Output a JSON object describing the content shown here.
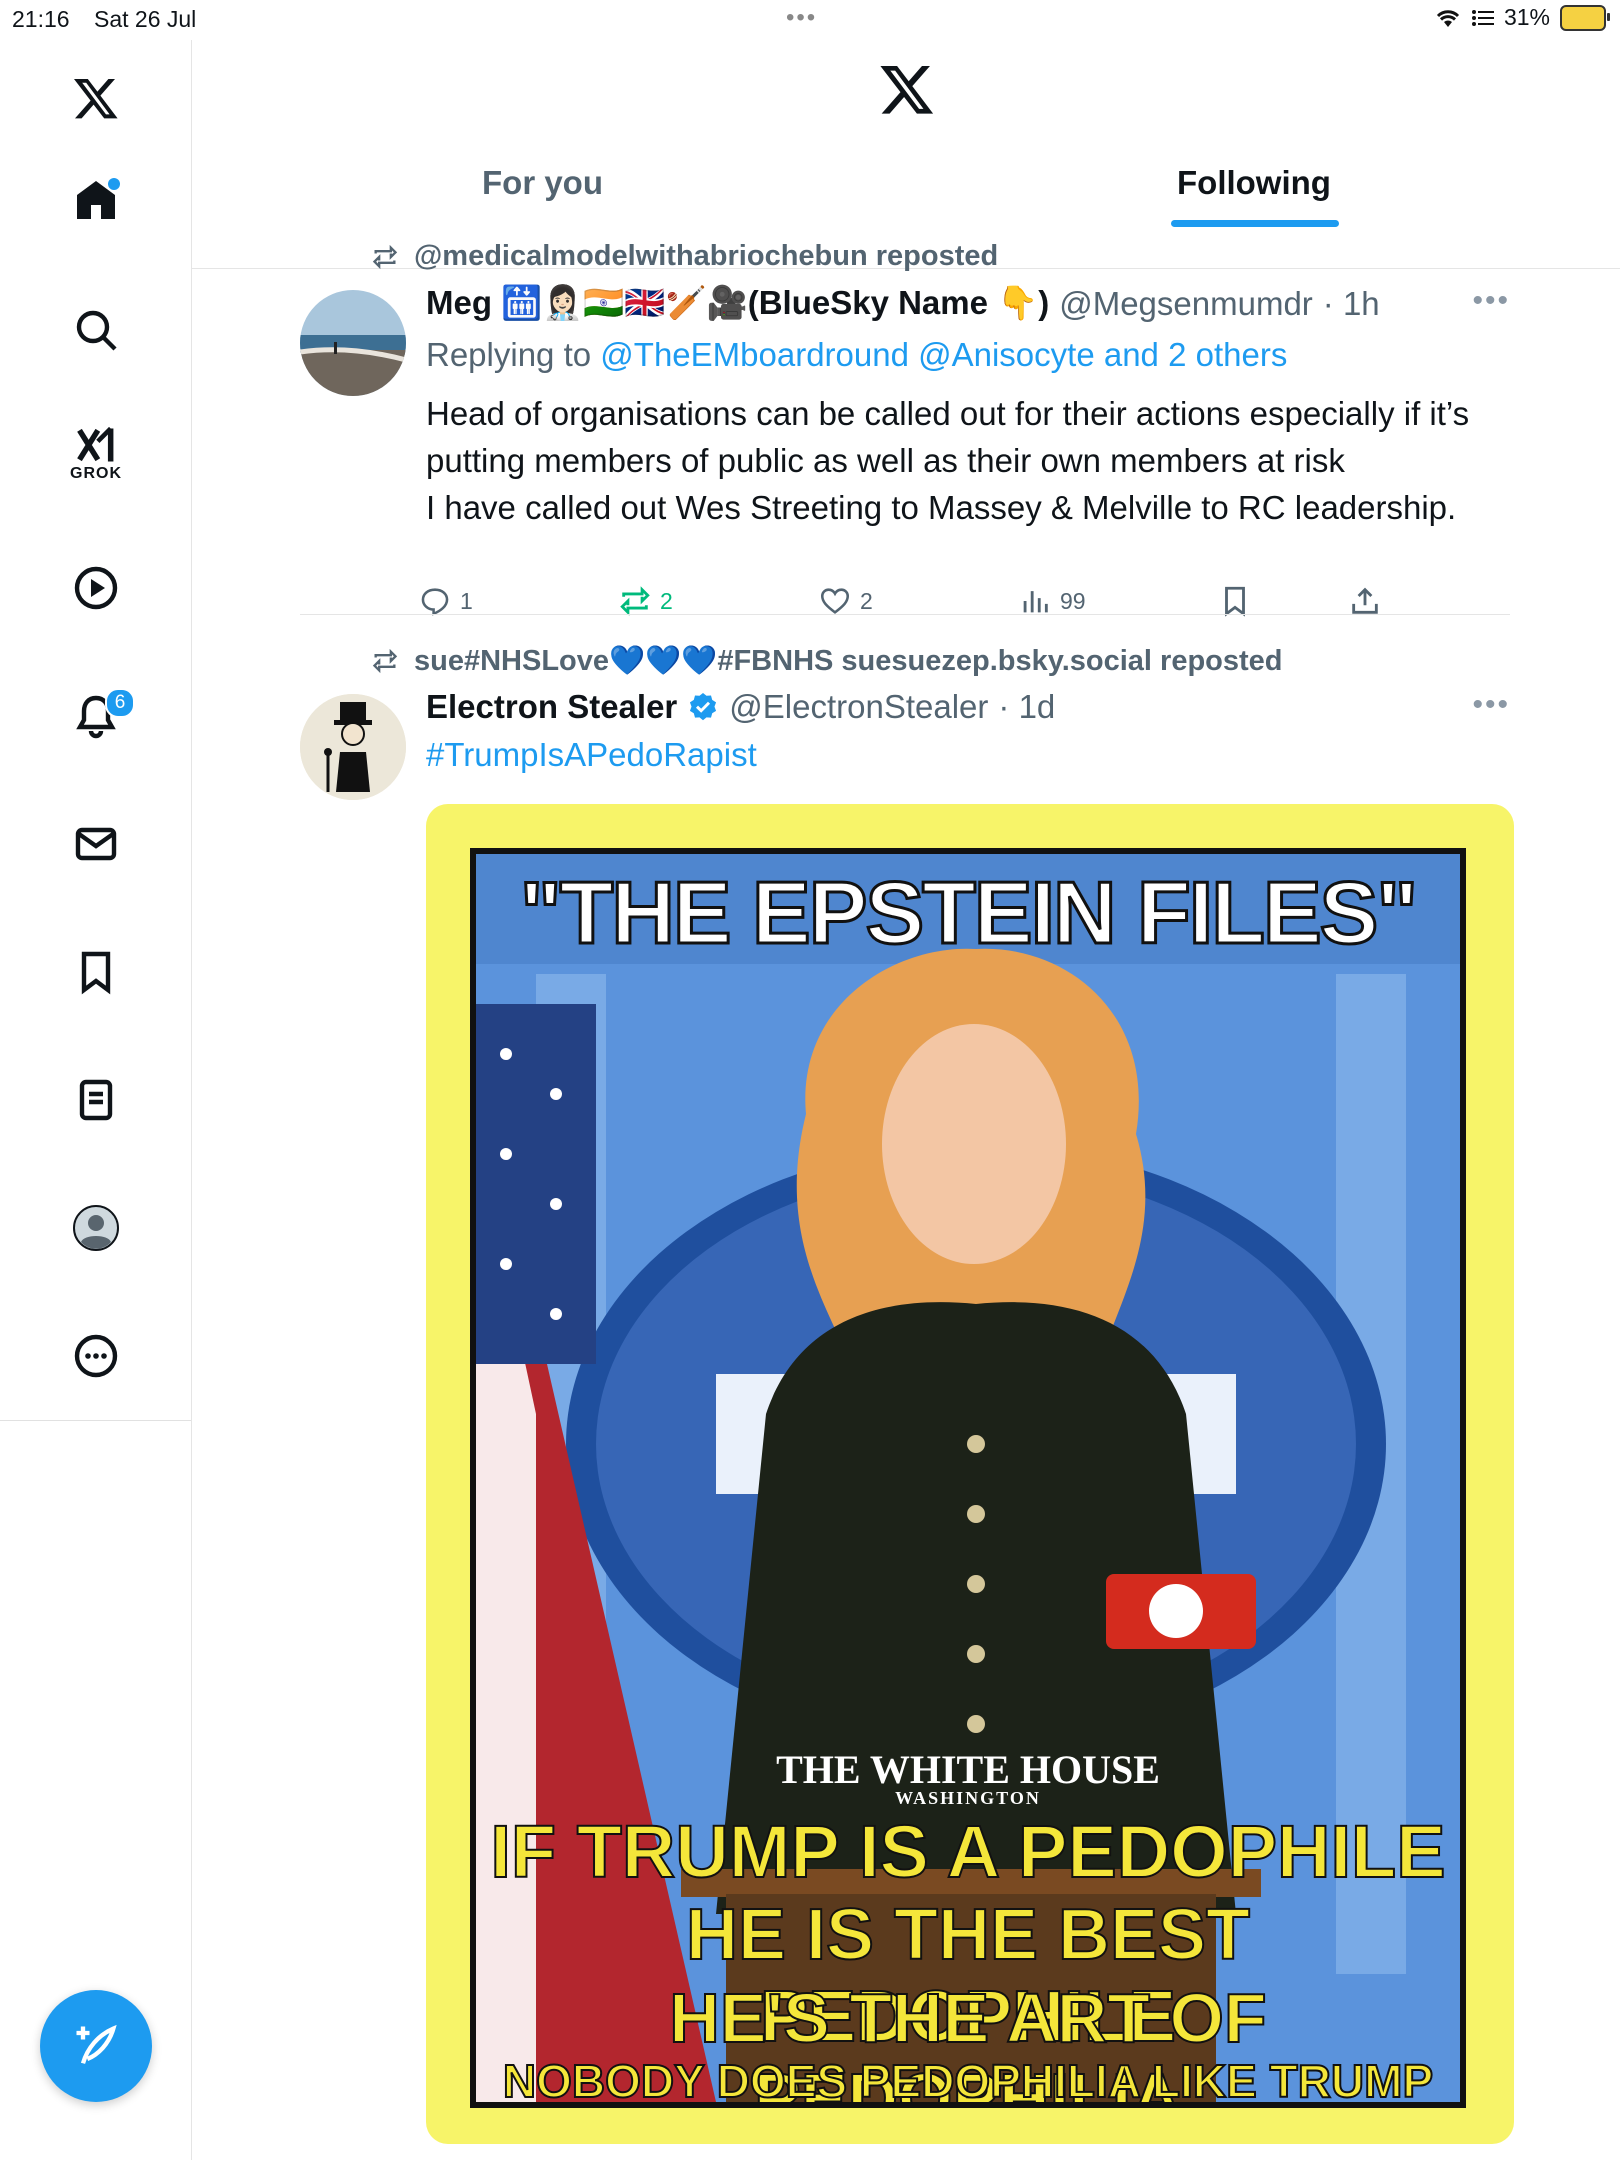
{
  "status_bar": {
    "time": "21:16",
    "date": "Sat 26 Jul",
    "battery": "31%"
  },
  "sidebar": {
    "grok_label": "GROK",
    "notifications_count": "6"
  },
  "tabs": [
    {
      "label": "For you"
    },
    {
      "label": "Following"
    }
  ],
  "posts": [
    {
      "repost_by": "@medicalmodelwithabriochebun reposted",
      "name": "Meg 🛗👩🏻‍⚕️🇮🇳🇬🇧🏏🎥(BlueSky Name 👇)",
      "handle": "@Megsenmumdr",
      "time": "· 1h",
      "replying_prefix": "Replying to",
      "replying_targets": "@TheEMboardround @Anisocyte and 2 others",
      "text_lines": [
        "Head of organisations can be called out for their actions especially if it’s",
        "putting members of public as well as their own members at risk",
        "I have called out Wes Streeting to Massey & Melville to RC leadership."
      ],
      "replies": "1",
      "reposts": "2",
      "likes": "2",
      "views": "99"
    },
    {
      "repost_by": "sue#NHSLove💙💙💙#FBNHS suesuezep.bsky.social reposted",
      "name": "Electron Stealer",
      "handle": "@ElectronStealer",
      "time": "· 1d",
      "hashtag": "#TrumpIsAPedoRapist",
      "image": {
        "title": "\"THE EPSTEIN FILES\"",
        "podium_text": "THE WHITE HOUSE",
        "podium_sub": "WASHINGTON",
        "caption_lines": [
          "IF TRUMP IS A PEDOPHILE",
          "HE IS THE BEST PEDOPHILE",
          "HE'S THE ART OF PEDOPHILIA",
          "NOBODY DOES PEDOPHILIA LIKE TRUMP"
        ]
      }
    }
  ]
}
